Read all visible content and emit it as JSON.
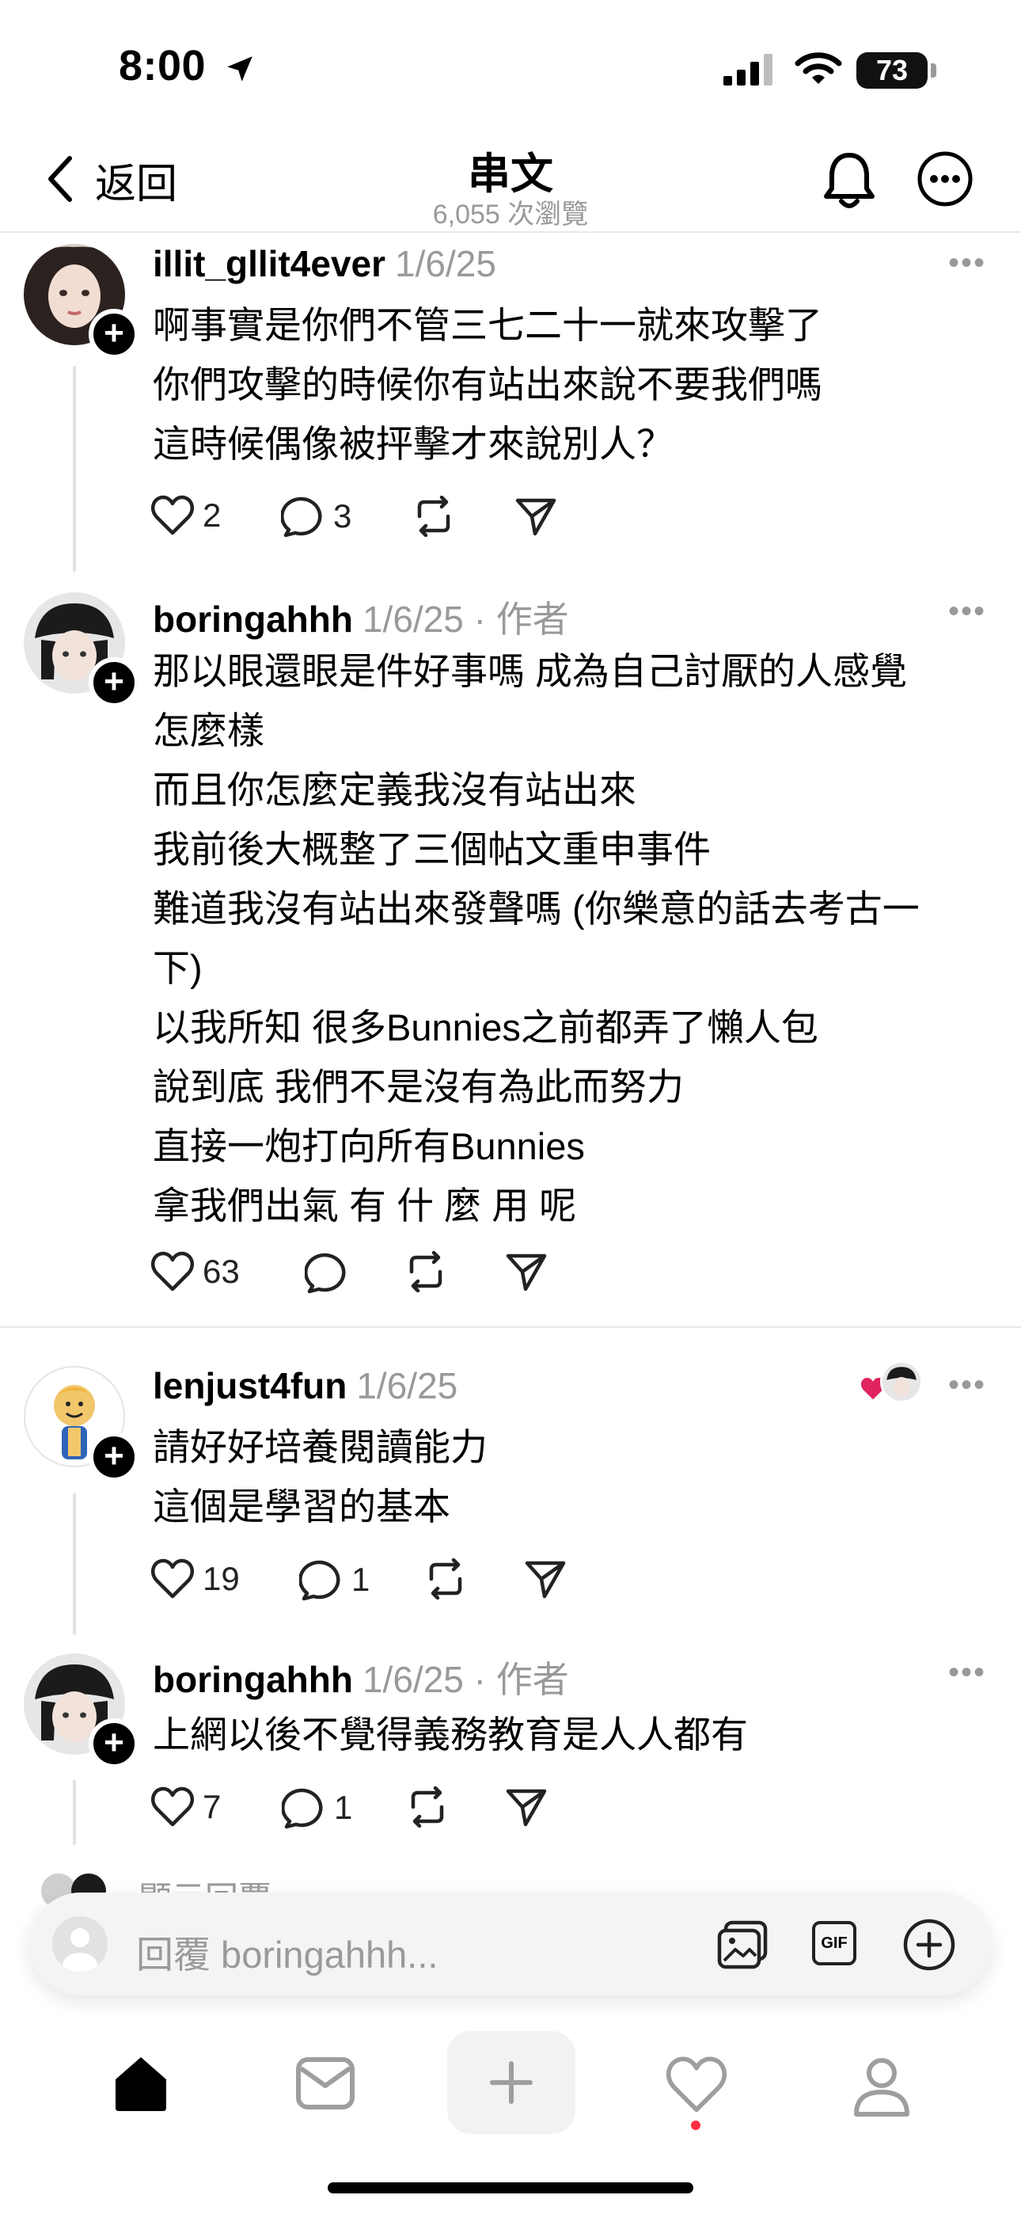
{
  "status_bar": {
    "time": "8:00",
    "battery": "73"
  },
  "header": {
    "back_label": "返回",
    "title": "串文",
    "views": "6,055 次瀏覽"
  },
  "posts": [
    {
      "username": "illit_gllit4ever",
      "date": "1/6/25",
      "lines": [
        "啊事實是你們不管三七二十一就來攻擊了",
        "你們攻擊的時候你有站出來說不要我們嗎",
        "這時候偶像被抨擊才來說別人？"
      ],
      "likes": "2",
      "replies": "3"
    },
    {
      "username": "boringahhh",
      "date": "1/6/25",
      "author_label": " · 作者",
      "lines": [
        "那以眼還眼是件好事嗎 成為自己討厭的人感覺",
        "怎麼樣",
        "而且你怎麼定義我沒有站出來",
        "我前後大概整了三個帖文重申事件",
        "難道我沒有站出來發聲嗎 (你樂意的話去考古一",
        "下)",
        "以我所知 很多Bunnies之前都弄了懶人包",
        "說到底 我們不是沒有為此而努力",
        "直接一炮打向所有Bunnies",
        "拿我們出氣 有 什 麼 用 呢"
      ],
      "likes": "63"
    },
    {
      "username": "lenjust4fun",
      "date": "1/6/25",
      "lines": [
        "請好好培養閱讀能力",
        "這個是學習的基本"
      ],
      "likes": "19",
      "replies": "1"
    },
    {
      "username": "boringahhh",
      "date": "1/6/25",
      "author_label": " · 作者",
      "lines": [
        "上網以後不覺得義務教育是人人都有"
      ],
      "likes": "7",
      "replies": "1"
    }
  ],
  "show_replies": "顯示回覆",
  "reply_bar": {
    "placeholder": "回覆 boringahhh..."
  },
  "colors": {
    "accent_heart": "#e0245e",
    "muted": "#999999",
    "notification_dot": "#ff3040"
  }
}
